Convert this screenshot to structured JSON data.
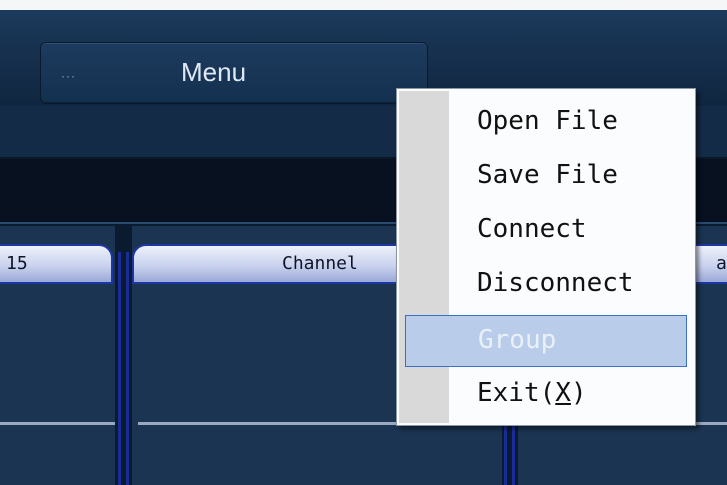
{
  "toolbar": {
    "menu_button": {
      "dots": "···",
      "label": "Menu"
    }
  },
  "channels": [
    {
      "header": "15"
    },
    {
      "header": "Channel"
    },
    {
      "header": "ar"
    }
  ],
  "context_menu": {
    "items": [
      {
        "label": "Open File",
        "enabled": true,
        "highlighted": false
      },
      {
        "label": "Save File",
        "enabled": true,
        "highlighted": false
      },
      {
        "label": "Connect",
        "enabled": true,
        "highlighted": false
      },
      {
        "label": "Disconnect",
        "enabled": true,
        "highlighted": false
      },
      {
        "label": "Group",
        "enabled": false,
        "highlighted": true
      },
      {
        "label_prefix": "Exit(",
        "mnemonic": "X",
        "label_suffix": ")",
        "enabled": true,
        "highlighted": false
      }
    ]
  },
  "colors": {
    "background": "#0d1e34",
    "header_border": "#1d36a5",
    "highlight": "#b9cdea"
  }
}
